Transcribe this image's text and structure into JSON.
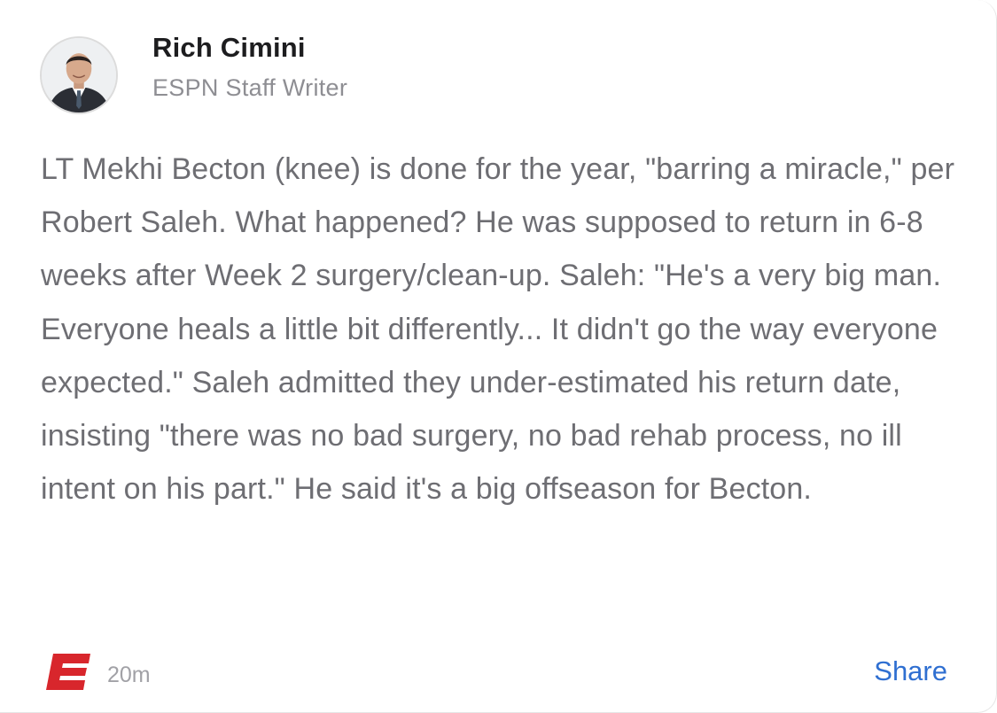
{
  "post": {
    "author_name": "Rich Cimini",
    "author_role": "ESPN Staff Writer",
    "body": "LT Mekhi Becton (knee) is done for the year, \"barring a miracle,\" per Robert Saleh. What happened? He was supposed to return in 6-8 weeks after Week 2 surgery/clean-up. Saleh: \"He's a very big man. Everyone heals a little bit differently... It didn't go the way everyone expected.\" Saleh admitted they under-estimated his return date, insisting \"there was no bad surgery, no bad rehab process, no ill intent on his part.\" He said it's a big offseason for Becton.",
    "timestamp": "20m",
    "share_label": "Share"
  },
  "icons": {
    "avatar": "author-avatar-photo",
    "source_logo": "espn-logo-icon"
  },
  "colors": {
    "espn_red": "#d8262c",
    "link_blue": "#2f6fd1",
    "body_gray": "#6e6e73"
  }
}
